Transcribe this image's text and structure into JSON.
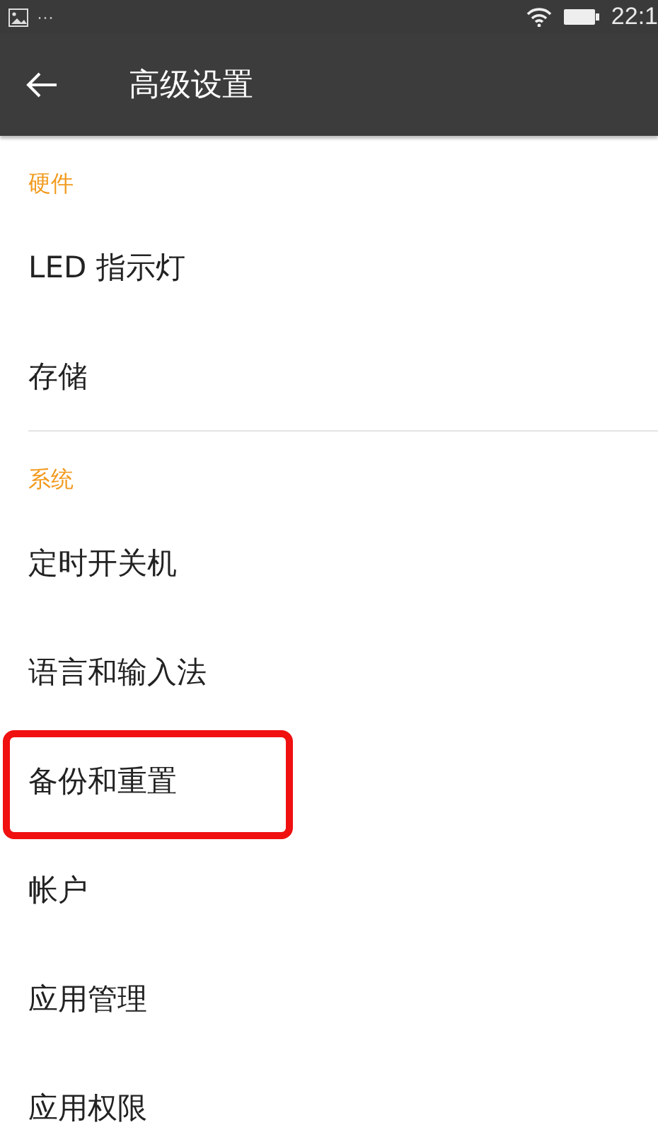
{
  "status_bar": {
    "time": "22:1",
    "notification": "···"
  },
  "app_bar": {
    "title": "高级设置"
  },
  "sections": [
    {
      "title": "硬件",
      "items": [
        {
          "label": "LED 指示灯",
          "highlighted": false
        },
        {
          "label": "存储",
          "highlighted": false
        }
      ]
    },
    {
      "title": "系统",
      "items": [
        {
          "label": "定时开关机",
          "highlighted": false
        },
        {
          "label": "语言和输入法",
          "highlighted": false
        },
        {
          "label": "备份和重置",
          "highlighted": true
        },
        {
          "label": "帐户",
          "highlighted": false
        },
        {
          "label": "应用管理",
          "highlighted": false
        },
        {
          "label": "应用权限",
          "highlighted": false
        }
      ]
    }
  ]
}
